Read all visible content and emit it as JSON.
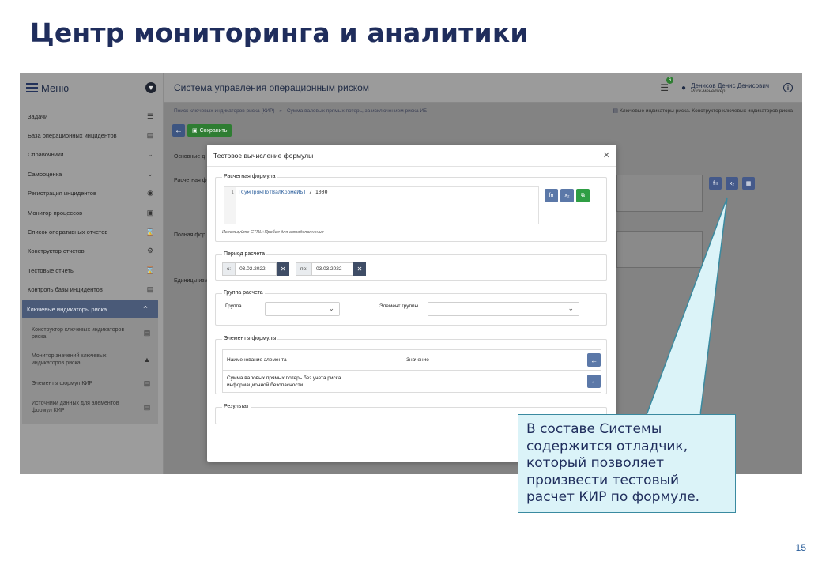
{
  "slide": {
    "title": "Центр мониторинга и аналитики",
    "page_number": "15"
  },
  "sidebar": {
    "menu_label": "Меню",
    "items": [
      {
        "label": "Задачи",
        "icon": "list-check-icon"
      },
      {
        "label": "База операционных инцидентов",
        "icon": "table-icon"
      },
      {
        "label": "Справочники",
        "icon": "chevron-down-icon"
      },
      {
        "label": "Самооценка",
        "icon": "chevron-down-icon"
      },
      {
        "label": "Регистрация инцидентов",
        "icon": "circle-icon"
      },
      {
        "label": "Монитор процессов",
        "icon": "monitor-icon"
      },
      {
        "label": "Список оперативных отчетов",
        "icon": "hourglass-icon"
      },
      {
        "label": "Конструктор отчетов",
        "icon": "gears-icon"
      },
      {
        "label": "Тестовые отчеты",
        "icon": "hourglass-icon"
      },
      {
        "label": "Контроль базы инцидентов",
        "icon": "database-icon"
      },
      {
        "label": "Ключевые индикаторы риска",
        "icon": "chevron-up-icon"
      }
    ],
    "sub_items": [
      {
        "label": "Конструктор ключевых индикаторов риска",
        "line1": "Конструктор ключевых индикаторов",
        "line2": "риска"
      },
      {
        "label": "Монитор значений ключевых индикаторов риска",
        "line1": "Монитор значений ключевых",
        "line2": "индикаторов риска"
      },
      {
        "label": "Элементы формул КИР",
        "line1": "Элементы формул КИР",
        "line2": ""
      },
      {
        "label": "Источники данных для элементов формул КИР",
        "line1": "Источники данных для элементов",
        "line2": "формул КИР"
      }
    ]
  },
  "header": {
    "app_title": "Система управления операционным риском",
    "notification_count": "6",
    "user_name": "Денисов Денис Денисович",
    "user_role": "Риск-менеджер"
  },
  "breadcrumb": {
    "items": [
      "Поиск ключевых индикаторов риска (КИР)",
      "Сумма валовых прямых потерь, за исключением риска ИБ"
    ],
    "separator": "»",
    "right": "Ключевые индикаторы риска. Конструктор ключевых индикаторов риска"
  },
  "toolbar": {
    "save_label": "Сохранить"
  },
  "background_form": {
    "tab_label": "Основные д",
    "formula_label": "Расчетная ф",
    "full_formula_label": "Полная фор",
    "units_label": "Единицы изм"
  },
  "modal": {
    "title": "Тестовое вычисление формулы",
    "formula_section": "Расчетная формула",
    "formula_line_number": "1",
    "formula_ref": "[СумПрямПотВалКромеИБ]",
    "formula_rest": " / 1000",
    "formula_hint": "Используйте CTRL+Пробел для автодополнения",
    "period_section": "Период расчета",
    "date_from_prefix": "с:",
    "date_from": "03.02.2022",
    "date_to_prefix": "по:",
    "date_to": "03.03.2022",
    "group_section": "Группа расчета",
    "group_label": "Группа",
    "group_element_label": "Элемент группы",
    "elements_section": "Элементы формулы",
    "table_headers": [
      "Наименование элемента",
      "Значение"
    ],
    "table_rows": [
      {
        "name_line1": "Сумма валовых прямых потерь без учета риска",
        "name_line2": "информационной безопасности",
        "value": ""
      }
    ],
    "result_section": "Результат"
  },
  "callout": {
    "text": "В составе Системы содержится отладчик, который позволяет произвести тестовый расчет КИР по формуле."
  }
}
